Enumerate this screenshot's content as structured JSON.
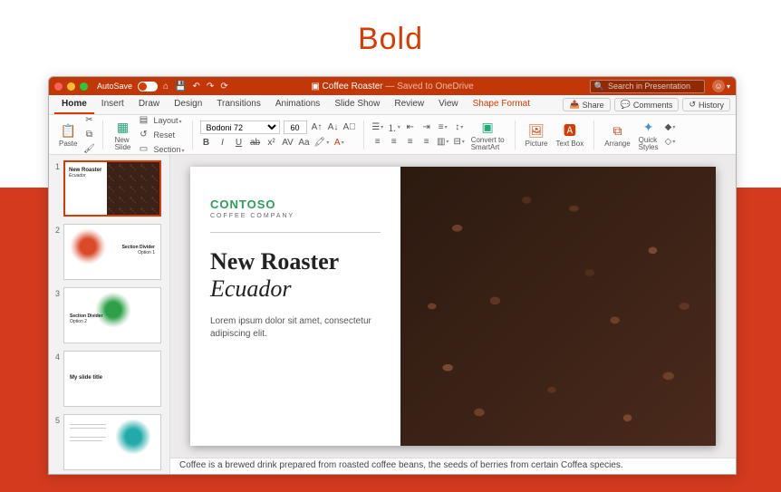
{
  "page": {
    "heading": "Bold"
  },
  "titlebar": {
    "autosave_label": "AutoSave",
    "autosave_state": "ON",
    "doc_title": "Coffee Roaster",
    "doc_status": "— Saved to OneDrive",
    "search_placeholder": "Search in Presentation"
  },
  "tabs": {
    "items": [
      "Home",
      "Insert",
      "Draw",
      "Design",
      "Transitions",
      "Animations",
      "Slide Show",
      "Review",
      "View",
      "Shape Format"
    ],
    "active": "Home",
    "contextual": "Shape Format",
    "right": {
      "share": "Share",
      "comments": "Comments",
      "history": "History"
    }
  },
  "ribbon": {
    "paste": "Paste",
    "new_slide": "New\nSlide",
    "layout": "Layout",
    "reset": "Reset",
    "section": "Section",
    "font_name": "Bodoni 72",
    "font_size": "60",
    "convert": "Convert to\nSmartArt",
    "picture": "Picture",
    "textbox": "Text Box",
    "arrange": "Arrange",
    "quick_styles": "Quick\nStyles"
  },
  "slides": [
    {
      "num": "1",
      "title": "New Roaster",
      "sub": "Ecuador"
    },
    {
      "num": "2",
      "title": "Section Divider",
      "sub": "Option 1"
    },
    {
      "num": "3",
      "title": "Section Divider",
      "sub": "Option 2"
    },
    {
      "num": "4",
      "title": "My slide title",
      "sub": ""
    },
    {
      "num": "5",
      "title": "Brand",
      "sub": ""
    }
  ],
  "canvas": {
    "brand": "CONTOSO",
    "brand_sub": "COFFEE COMPANY",
    "title1": "New Roaster",
    "title2": "Ecuador",
    "body": "Lorem ipsum dolor sit amet, consectetur adipiscing elit."
  },
  "notes": "Coffee is a brewed drink prepared from roasted coffee beans, the seeds of berries from certain Coffea species."
}
